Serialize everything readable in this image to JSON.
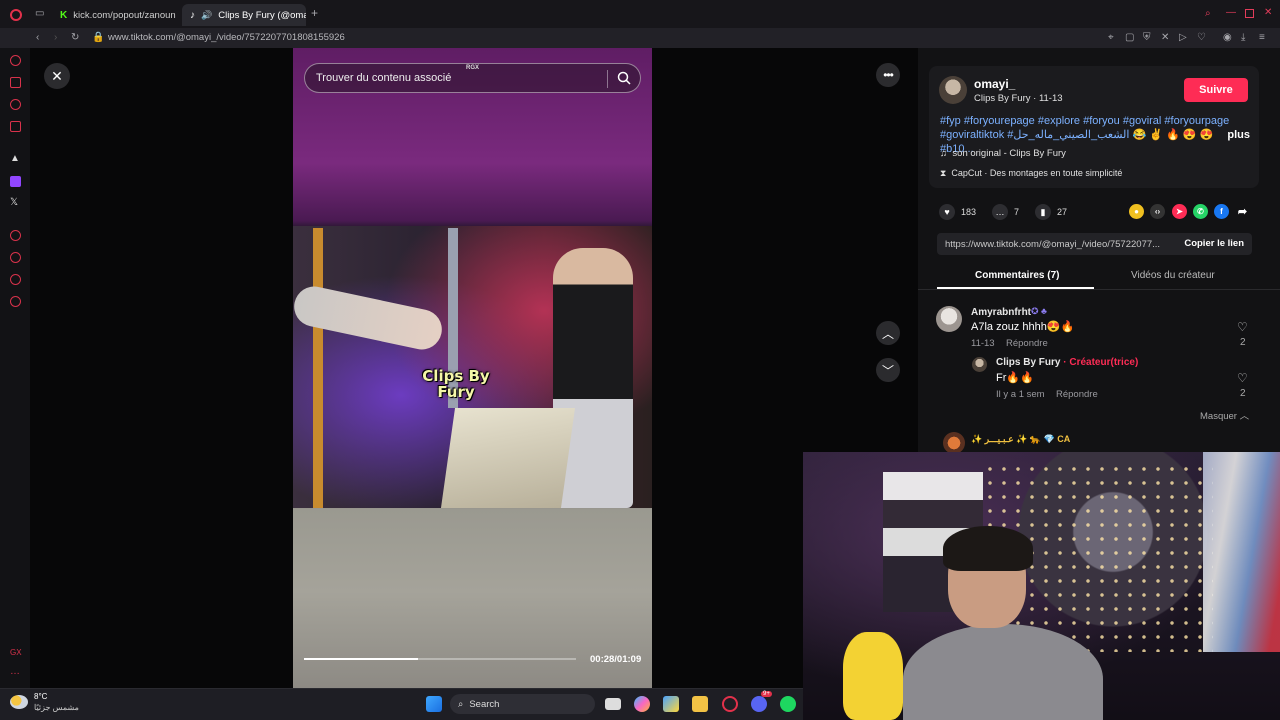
{
  "browser": {
    "tabs": [
      {
        "label": "kick.com/popout/zanoun"
      },
      {
        "label": "Clips By Fury (@omay"
      }
    ],
    "new_tab": "+",
    "url": "www.tiktok.com/@omayi_/video/7572207701808155926"
  },
  "player": {
    "search_placeholder": "Trouver du contenu associé",
    "search_badge": "RGX",
    "caption": "Clips By Fury",
    "progress": 0.42,
    "timecode": "00:28/01:09"
  },
  "author": {
    "username": "omayi_",
    "display_name": "Clips By Fury",
    "date": "11-13",
    "follow_label": "Suivre",
    "hashtags_line1": "#fyp #foryourepage #explore #foryou #goviral #foryourpage",
    "hashtags_line2": "#goviraltiktok #الشعب_الصيني_ماله_حل 😂 ✌ 🔥 😍 😍 #b10...",
    "more_label": "plus",
    "sound": "son original - Clips By Fury",
    "capcut": "CapCut · Des montages en toute simplicité"
  },
  "stats": {
    "likes": "183",
    "comments": "7",
    "saves": "27"
  },
  "share": {
    "link": "https://www.tiktok.com/@omayi_/video/75722077...",
    "copy_label": "Copier le lien"
  },
  "panel_tabs": {
    "comments": "Commentaires (7)",
    "creator_videos": "Vidéos du créateur"
  },
  "comments": [
    {
      "name": "Amyrabnfrht",
      "text": "A7la zouz hhhh😍🔥",
      "date": "11-13",
      "reply": "Répondre",
      "likes": "2"
    },
    {
      "name": "Clips By Fury",
      "creator_tag": "· Créateur(trice)",
      "text": "Fr🔥🔥",
      "date": "Il y a 1 sem",
      "reply": "Répondre",
      "likes": "2"
    }
  ],
  "hide_label": "Masquer",
  "next_comment_name": "✨ عـبـيـــر ✨ 🐆 💎 CA",
  "taskbar": {
    "weather_temp": "8°C",
    "weather_desc": "مشمس جزئيًا",
    "search_label": "Search",
    "discord_badge": "9+"
  },
  "colors": {
    "accent": "#fe2c55",
    "hashtag": "#7cb1ff",
    "opera_red": "#d8324b"
  }
}
